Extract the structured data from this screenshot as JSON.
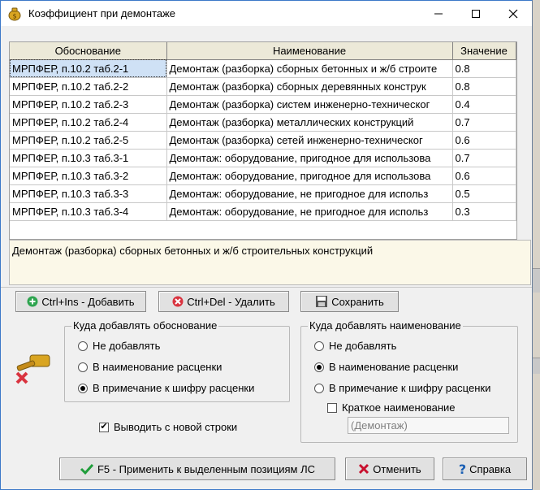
{
  "window": {
    "title": "Коэффициент при демонтаже",
    "icon": "money-bag-icon"
  },
  "grid": {
    "columns": [
      "Обоснование",
      "Наименование",
      "Значение"
    ],
    "rows": [
      {
        "basis": "МРПФЕР, п.10.2 таб.2-1",
        "name": "Демонтаж (разборка) сборных бетонных и ж/б строите",
        "value": "0.8"
      },
      {
        "basis": "МРПФЕР, п.10.2 таб.2-2",
        "name": "Демонтаж (разборка) сборных деревянных конструк",
        "value": "0.8"
      },
      {
        "basis": "МРПФЕР, п.10.2 таб.2-3",
        "name": "Демонтаж (разборка) систем инженерно-техническог",
        "value": "0.4"
      },
      {
        "basis": "МРПФЕР, п.10.2 таб.2-4",
        "name": "Демонтаж (разборка) металлических конструкций",
        "value": "0.7"
      },
      {
        "basis": "МРПФЕР, п.10.2 таб.2-5",
        "name": "Демонтаж (разборка) сетей инженерно-техническог",
        "value": "0.6"
      },
      {
        "basis": "МРПФЕР, п.10.3 таб.3-1",
        "name": "Демонтаж: оборудование, пригодное для использова",
        "value": "0.7"
      },
      {
        "basis": "МРПФЕР, п.10.3 таб.3-2",
        "name": "Демонтаж: оборудование, пригодное для использова",
        "value": "0.6"
      },
      {
        "basis": "МРПФЕР, п.10.3 таб.3-3",
        "name": "Демонтаж: оборудование, не пригодное для использ",
        "value": "0.5"
      },
      {
        "basis": "МРПФЕР, п.10.3 таб.3-4",
        "name": "Демонтаж: оборудование, не пригодное для использ",
        "value": "0.3"
      }
    ],
    "selected_index": 0
  },
  "description": "Демонтаж (разборка) сборных бетонных и ж/б строительных конструкций",
  "toolbar": {
    "add_label": "Ctrl+Ins - Добавить",
    "delete_label": "Ctrl+Del - Удалить",
    "save_label": "Сохранить"
  },
  "basis_group": {
    "title": "Куда добавлять обоснование",
    "options": [
      "Не добавлять",
      "В наименование расценки",
      "В примечание к шифру расценки"
    ],
    "selected_index": 2
  },
  "name_group": {
    "title": "Куда добавлять наименование",
    "options": [
      "Не добавлять",
      "В наименование расценки",
      "В примечание к шифру расценки"
    ],
    "selected_index": 1,
    "short_name_label": "Краткое наименование",
    "short_name_checked": false,
    "short_name_value": "(Демонтаж)"
  },
  "new_line": {
    "label": "Выводить с новой строки",
    "checked": true
  },
  "footer": {
    "apply_label": "F5 - Применить к выделенным позициям ЛС",
    "cancel_label": "Отменить",
    "help_label": "Справка"
  },
  "colors": {
    "title_border": "#3c78c8",
    "selection": "#cfe1f5",
    "description_bg": "#fbf8e8",
    "add_icon": "#2ea44f",
    "delete_icon": "#d9333f",
    "apply_check": "#1f9d3a",
    "cancel_x": "#c8102e",
    "help_q": "#1a5fb4"
  }
}
